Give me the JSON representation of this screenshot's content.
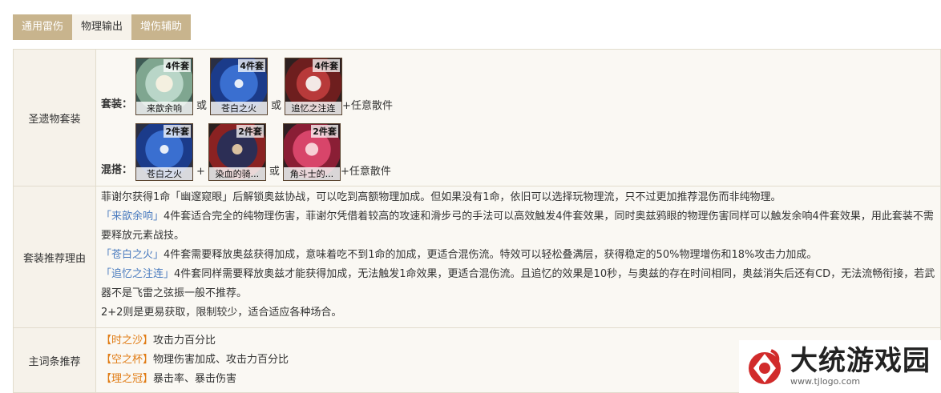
{
  "tabs": [
    {
      "label": "通用雷伤",
      "active": false
    },
    {
      "label": "物理输出",
      "active": true
    },
    {
      "label": "增伤辅助",
      "active": false
    }
  ],
  "artifact_section": {
    "header": "圣遗物套装",
    "line1": {
      "label": "套装：",
      "items": [
        {
          "count": "4件套",
          "name": "来歆余响",
          "icon": "echoes-artifact-icon"
        },
        {
          "count": "4件套",
          "name": "苍白之火",
          "icon": "pale-flame-artifact-icon"
        },
        {
          "count": "4件套",
          "name": "追忆之注连",
          "icon": "shimenawa-artifact-icon"
        }
      ],
      "seps": [
        "或",
        "或"
      ],
      "suffix": "+任意散件"
    },
    "line2": {
      "label": "混搭：",
      "items": [
        {
          "count": "2件套",
          "name": "苍白之火",
          "icon": "pale-flame-artifact-icon"
        },
        {
          "count": "2件套",
          "name": "染血的骑...",
          "icon": "bloodstained-artifact-icon"
        },
        {
          "count": "2件套",
          "name": "角斗士的...",
          "icon": "gladiator-artifact-icon"
        }
      ],
      "seps": [
        "+",
        "或"
      ],
      "suffix": "+任意散件"
    }
  },
  "reason_section": {
    "header": "套装推荐理由",
    "p1": "菲谢尔获得1命「幽邃窥眼」后解锁奥兹协战，可以吃到高额物理加成。但如果没有1命，依旧可以选择玩物理流，只不过更加推荐混伤而非纯物理。",
    "p2_link": "「来歆余响」",
    "p2_text": "4件套适合完全的纯物理伤害，菲谢尔凭借着较高的攻速和滑步弓的手法可以高效触发4件套效果，同时奥兹鸦眼的物理伤害同样可以触发余响4件套效果，用此套装不需要释放元素战技。",
    "p3_link": "「苍白之火」",
    "p3_text": "4件套需要释放奥兹获得加成，意味着吃不到1命的加成，更适合混伤流。特效可以轻松叠满层，获得稳定的50%物理增伤和18%攻击力加成。",
    "p4_link": "「追忆之注连」",
    "p4_text": "4件套同样需要释放奥兹才能获得加成，无法触发1命效果，更适合混伤流。且追忆的效果是10秒，与奥兹的存在时间相同，奥兹消失后还有CD，无法流畅衔接，若武器不是飞雷之弦振一般不推荐。",
    "p5": "2+2则是更易获取，限制较少，适合适应各种场合。"
  },
  "stat_section": {
    "header": "主词条推荐",
    "lines": [
      {
        "tag": "【时之沙】",
        "text": "攻击力百分比"
      },
      {
        "tag": "【空之杯】",
        "text": "物理伤害加成、攻击力百分比"
      },
      {
        "tag": "【理之冠】",
        "text": "暴击率、暴击伤害"
      }
    ]
  },
  "watermark": {
    "title": "大统游戏园",
    "url": "www.tjlogo.com",
    "icon": "brand-logo-icon"
  },
  "colors": {
    "tab_inactive": "#c8b48d",
    "tab_active": "#f6f2ea",
    "link": "#4a7bbf",
    "tag_orange": "#e07b14"
  }
}
